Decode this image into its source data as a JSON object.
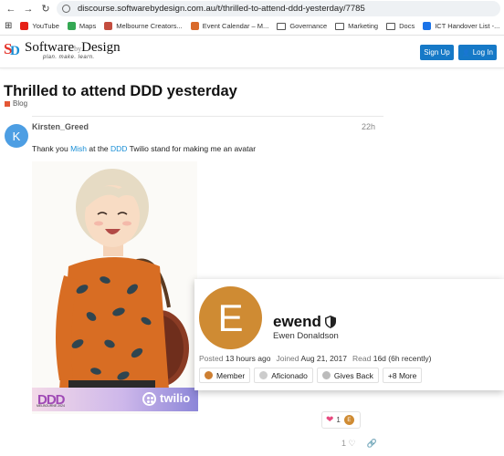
{
  "browser": {
    "url": "discourse.softwarebydesign.com.au/t/thrilled-to-attend-ddd-yesterday/7785",
    "bookmarks": [
      "YouTube",
      "Maps",
      "Melbourne Creators...",
      "Event Calendar – M...",
      "Governance",
      "Marketing",
      "Docs",
      "ICT Handover List -..."
    ]
  },
  "header": {
    "logo_name": "Software",
    "logo_by": "by",
    "logo_design": "Design",
    "logo_tagline": "plan. make. learn.",
    "signup_label": "Sign Up",
    "login_label": "Log In"
  },
  "topic": {
    "title": "Thrilled to attend DDD yesterday",
    "category": "Blog"
  },
  "post": {
    "avatar_letter": "K",
    "username": "Kirsten_Greed",
    "time": "22h",
    "text_1": "Thank you ",
    "text_mention": "Mish",
    "text_2": " at the ",
    "text_link": "DDD",
    "text_3": " Twilio stand for making me an avatar",
    "banner_ddd": "DDD",
    "banner_ddd_sub": "MELBOURNE 2024",
    "banner_twilio": "twilio",
    "reaction_count": "1",
    "reaction_avatar_letter": "E",
    "likes_count": "1"
  },
  "user_card": {
    "avatar_letter": "E",
    "username": "ewend",
    "full_name": "Ewen Donaldson",
    "posted_label": "Posted",
    "posted_value": "13 hours ago",
    "joined_label": "Joined",
    "joined_value": "Aug 21, 2017",
    "read_label": "Read",
    "read_value": "16d (6h recently)",
    "badges": [
      "Member",
      "Aficionado",
      "Gives Back",
      "+8 More"
    ]
  },
  "colors": {
    "primary": "#1679c7",
    "link": "#1a8fd6",
    "category": "#e45735",
    "avatar_k": "#4d9ee3",
    "avatar_e": "#cf8b33"
  }
}
